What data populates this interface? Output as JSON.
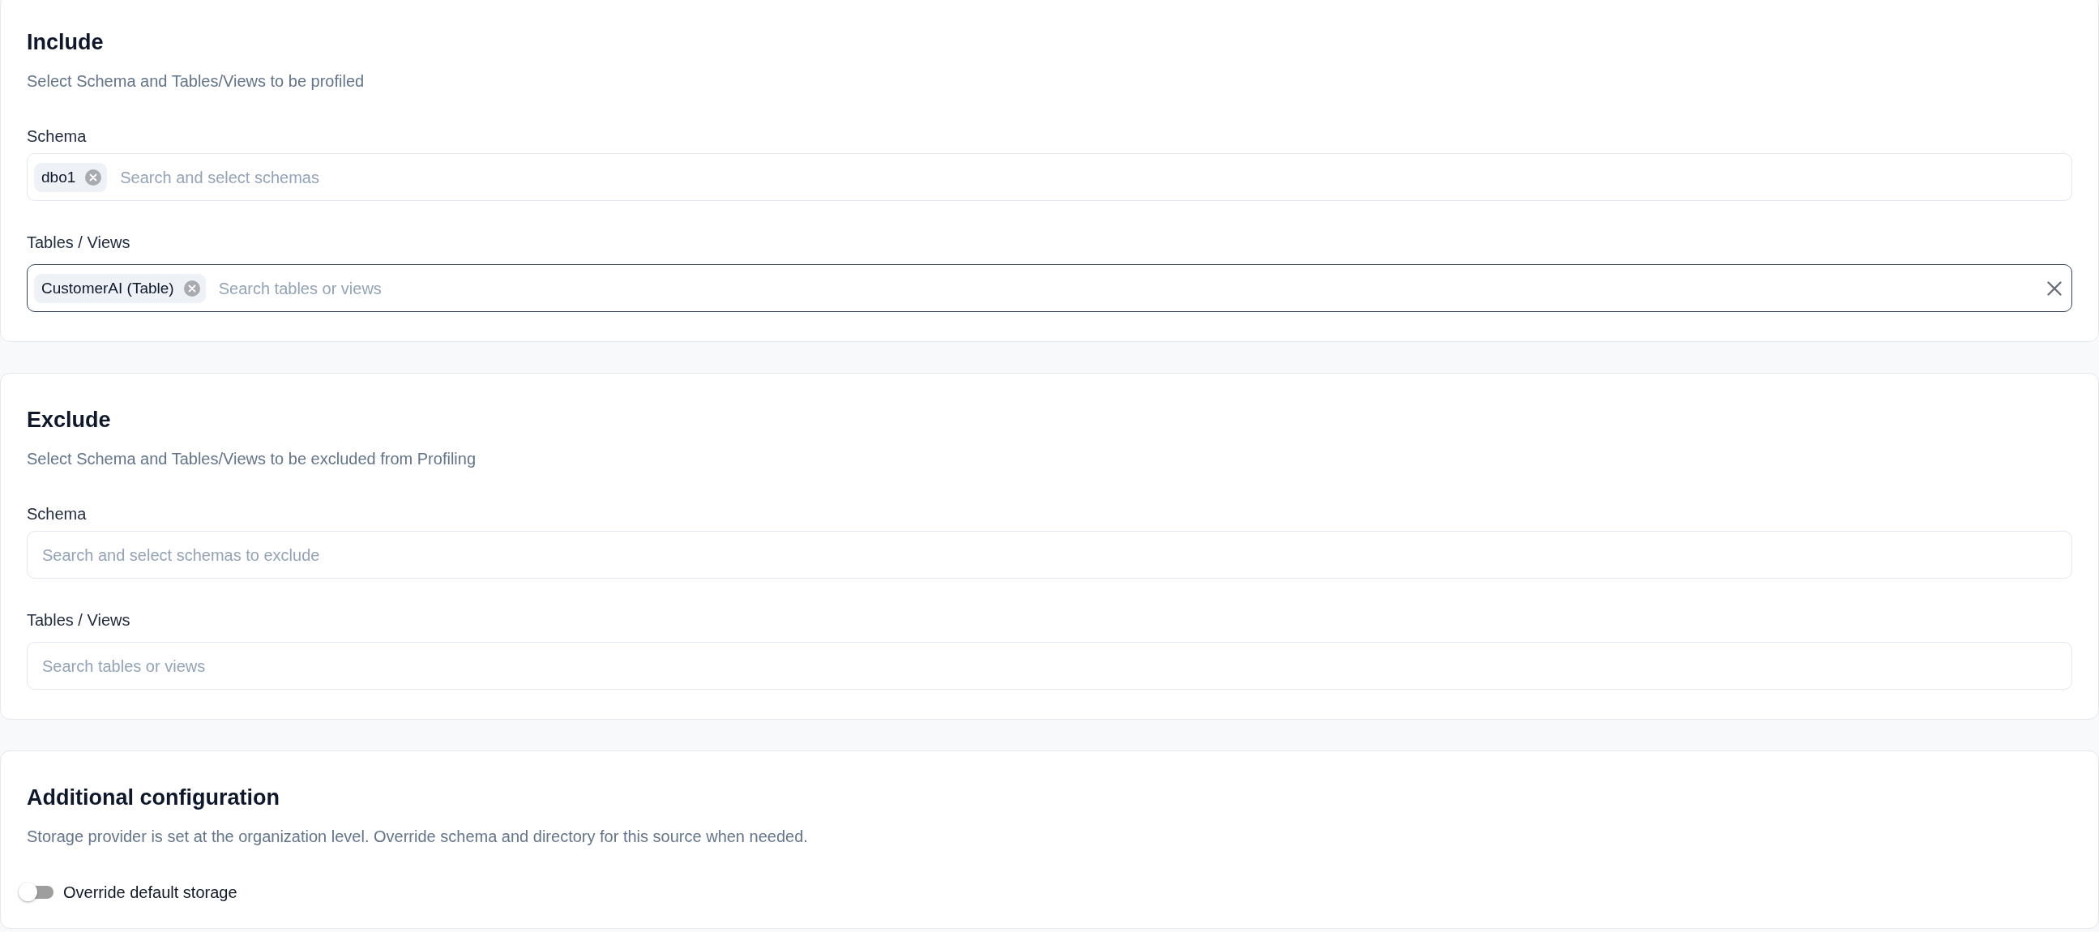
{
  "sections": [
    {
      "title": "Include",
      "description": "Select Schema and Tables/Views to be profiled",
      "fields": [
        {
          "label": "Schema",
          "chips": [
            "dbo1"
          ],
          "placeholder": "Search and select schemas",
          "focused": false,
          "clear_button": false
        },
        {
          "label": "Tables / Views",
          "chips": [
            "CustomerAI (Table)"
          ],
          "placeholder": "Search tables or views",
          "focused": true,
          "clear_button": true
        }
      ]
    },
    {
      "title": "Exclude",
      "description": "Select Schema and Tables/Views to be excluded from Profiling",
      "fields": [
        {
          "label": "Schema",
          "placeholder": "Search and select schemas to exclude",
          "focused": false,
          "clear_button": false
        },
        {
          "label": "Tables / Views",
          "placeholder": "Search tables or views",
          "focused": false,
          "clear_button": false
        }
      ]
    },
    {
      "title": "Additional configuration",
      "description": "Storage provider is set at the organization level. Override schema and directory for this source when needed.",
      "toggles": [
        {
          "label": "Override default storage",
          "on": false
        }
      ]
    }
  ]
}
